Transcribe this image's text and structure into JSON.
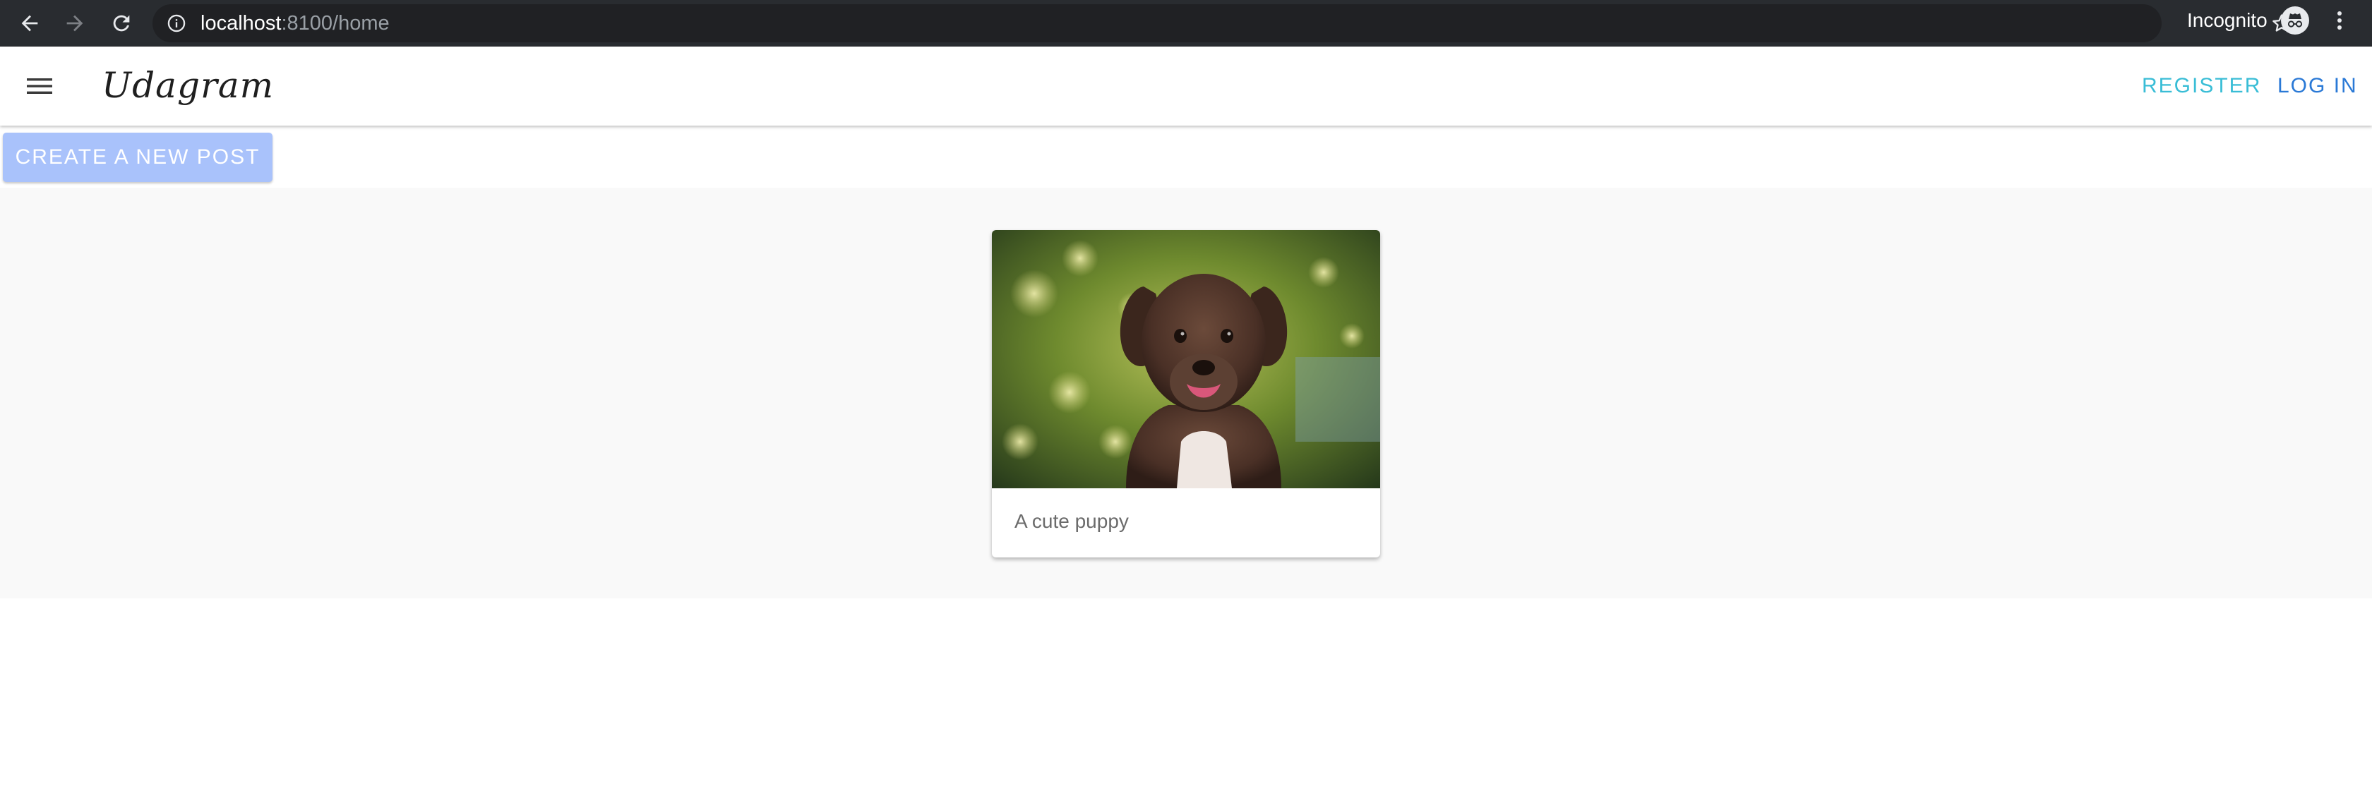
{
  "browser": {
    "url_host": "localhost",
    "url_rest": ":8100/home",
    "profile_label": "Incognito",
    "icons": {
      "back": "arrow-left-icon",
      "forward": "arrow-right-icon",
      "reload": "reload-icon",
      "info": "info-icon",
      "bookmark": "star-icon",
      "incognito": "incognito-icon",
      "menu": "vertical-dots-icon"
    }
  },
  "app": {
    "brand": "Udagram",
    "menu_icon": "hamburger-menu-icon",
    "nav": {
      "register_label": "REGISTER",
      "login_label": "LOG IN"
    },
    "colors": {
      "register": "#39bdd6",
      "login": "#2a79d6",
      "create_button_bg": "#a9c2fb",
      "feed_bg": "#f9f9f9"
    }
  },
  "actions": {
    "create_post_label": "CREATE A NEW POST"
  },
  "feed": {
    "posts": [
      {
        "image": "puppy-photo",
        "caption": "A cute puppy"
      }
    ]
  }
}
